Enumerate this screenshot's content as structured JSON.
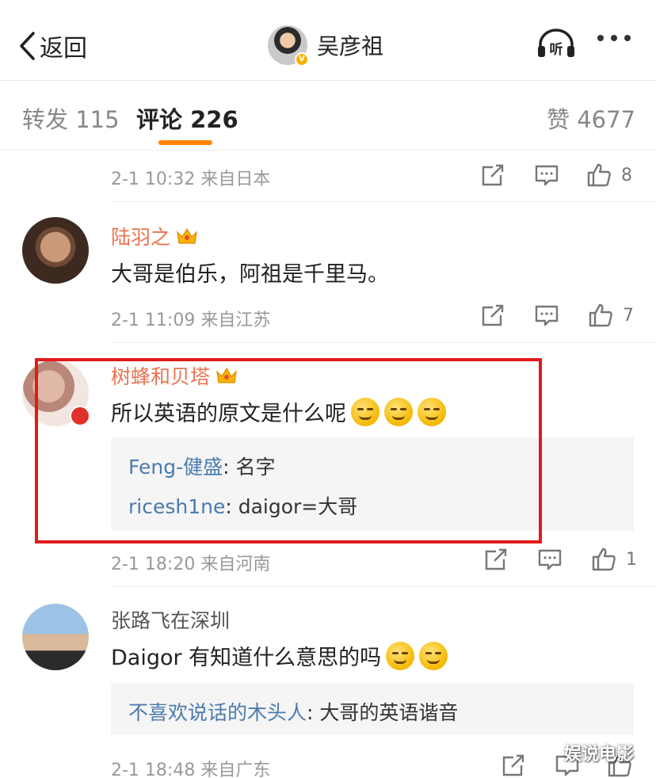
{
  "header": {
    "back_label": "返回",
    "title": "吴彦祖",
    "listen_label": "听",
    "verified_mark": "V"
  },
  "tabs": [
    {
      "label": "转发 115",
      "active": false
    },
    {
      "label": "评论 226",
      "active": true
    },
    {
      "label": "赞 4677",
      "active": false
    }
  ],
  "accent_color": "#ff8200",
  "comments": [
    {
      "meta": "2-1 10:32 来自日本",
      "likes": "8"
    },
    {
      "user": "陆羽之",
      "user_badge": "crown-icon",
      "text": "大哥是伯乐，阿祖是千里马。",
      "meta": "2-1 11:09 来自江苏",
      "likes": "7"
    },
    {
      "user": "树蜂和贝塔",
      "user_badge": "crown-icon",
      "text": "所以英语的原文是什么呢",
      "emojis": [
        "thinking-face-icon",
        "thinking-face-icon",
        "thinking-face-icon"
      ],
      "replies": [
        {
          "who": "Feng-健盛",
          "text": ": 名字"
        },
        {
          "who": "ricesh1ne",
          "text": ": daigor=大哥"
        }
      ],
      "meta": "2-1 18:20 来自河南",
      "likes": "1"
    },
    {
      "user": "张路飞在深圳",
      "text": "Daigor 有知道什么意思的吗",
      "emojis": [
        "thinking-icon",
        "laughing-tears-icon"
      ],
      "replies": [
        {
          "who": "不喜欢说话的木头人",
          "text": ": 大哥的英语谐音"
        }
      ],
      "meta": "2-1 18:48 来自广东"
    }
  ],
  "watermark": "娱说电影",
  "highlight_color": "#e21a1a"
}
